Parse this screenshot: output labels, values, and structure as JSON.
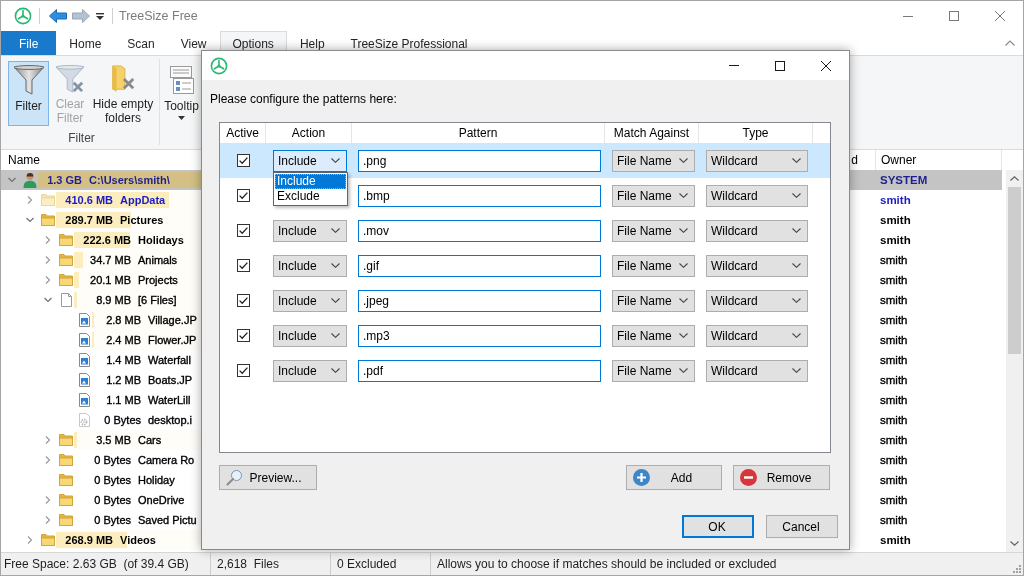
{
  "window": {
    "title": "TreeSize Free"
  },
  "ribbon": {
    "tabs": [
      {
        "label": "File",
        "kind": "backstage",
        "selected": false
      },
      {
        "label": "Home",
        "kind": "tab",
        "selected": false
      },
      {
        "label": "Scan",
        "kind": "tab",
        "selected": false
      },
      {
        "label": "View",
        "kind": "tab",
        "selected": false
      },
      {
        "label": "Options",
        "kind": "tab",
        "selected": true
      },
      {
        "label": "Help",
        "kind": "tab",
        "selected": false
      },
      {
        "label": "TreeSize Professional",
        "kind": "tab",
        "selected": false
      }
    ],
    "groups": [
      {
        "label": "Filter",
        "buttons": [
          {
            "label": "Filter",
            "kind": "filter",
            "selected": true,
            "disabled": false
          },
          {
            "label": "Clear Filter",
            "kind": "clear",
            "selected": false,
            "disabled": true
          },
          {
            "label": "Hide empty folders",
            "kind": "hide",
            "selected": false,
            "disabled": false
          }
        ]
      },
      {
        "buttons": [
          {
            "label": "Tooltip",
            "kind": "tooltip",
            "selected": false,
            "disabled": false
          }
        ]
      }
    ]
  },
  "tree": {
    "columns": [
      {
        "label": "Name"
      },
      {
        "label": "d"
      },
      {
        "label": "Owner"
      }
    ],
    "nodes": [
      {
        "size": "1.3 GB",
        "name": "C:\\Users\\smith\\",
        "owner": "SYSTEM",
        "kind": "user",
        "expanded": true,
        "selected": true,
        "bold": true,
        "color": "#1f1f8f",
        "level": 1,
        "children": [
          {
            "size": "410.6 MB",
            "name": "AppData",
            "owner": "smith",
            "kind": "hidden",
            "expanded": false,
            "selected": false,
            "bold": true,
            "color": "#1c1cc4",
            "level": 0.78
          },
          {
            "size": "289.7 MB",
            "name": "Pictures",
            "owner": "smith",
            "kind": "folder",
            "expanded": true,
            "selected": false,
            "bold": true,
            "color": "#000000",
            "level": 0.52,
            "children": [
              {
                "size": "222.6 MB",
                "name": "Holidays",
                "owner": "smith",
                "kind": "folder",
                "expanded": false,
                "selected": false,
                "bold": true,
                "color": "#000000",
                "level": 0.44
              },
              {
                "size": "34.7 MB",
                "name": "Animals",
                "owner": "smith",
                "kind": "folder",
                "expanded": false,
                "selected": false,
                "bold": false,
                "color": "#000000",
                "level": 0.07
              },
              {
                "size": "20.1 MB",
                "name": "Projects",
                "owner": "smith",
                "kind": "folder",
                "expanded": false,
                "selected": false,
                "bold": false,
                "color": "#000000",
                "level": 0.04
              },
              {
                "size": "8.9 MB",
                "name": "[6 Files]",
                "owner": "smith",
                "kind": "files",
                "expanded": true,
                "selected": false,
                "bold": false,
                "color": "#000000",
                "level": 0.02,
                "children": [
                  {
                    "size": "2.8 MB",
                    "name": "Village.JP",
                    "owner": "smith",
                    "kind": "image",
                    "selected": false,
                    "bold": false,
                    "color": "#000000",
                    "level": 0.02
                  },
                  {
                    "size": "2.4 MB",
                    "name": "Flower.JP",
                    "owner": "smith",
                    "kind": "image",
                    "selected": false,
                    "bold": false,
                    "color": "#000000",
                    "level": 0.02
                  },
                  {
                    "size": "1.4 MB",
                    "name": "Waterfall",
                    "owner": "smith",
                    "kind": "image",
                    "selected": false,
                    "bold": false,
                    "color": "#000000"
                  },
                  {
                    "size": "1.2 MB",
                    "name": "Boats.JP",
                    "owner": "smith",
                    "kind": "image",
                    "selected": false,
                    "bold": false,
                    "color": "#000000"
                  },
                  {
                    "size": "1.1 MB",
                    "name": "WaterLill",
                    "owner": "smith",
                    "kind": "image",
                    "selected": false,
                    "bold": false,
                    "color": "#000000"
                  },
                  {
                    "size": "0 Bytes",
                    "name": "desktop.i",
                    "owner": "smith",
                    "kind": "system",
                    "selected": false,
                    "bold": false,
                    "color": "#000000"
                  }
                ]
              },
              {
                "size": "3.5 MB",
                "name": "Cars",
                "owner": "smith",
                "kind": "folder",
                "expanded": false,
                "selected": false,
                "bold": false,
                "color": "#000000",
                "level": 0.02
              },
              {
                "size": "0 Bytes",
                "name": "Camera Ro",
                "owner": "smith",
                "kind": "folder",
                "expanded": false,
                "selected": false,
                "bold": false,
                "color": "#000000"
              },
              {
                "size": "0 Bytes",
                "name": "Holiday",
                "owner": "smith",
                "kind": "folder",
                "selected": false,
                "bold": false,
                "color": "#000000"
              },
              {
                "size": "0 Bytes",
                "name": "OneDrive",
                "owner": "smith",
                "kind": "folder",
                "expanded": false,
                "selected": false,
                "bold": false,
                "color": "#000000"
              },
              {
                "size": "0 Bytes",
                "name": "Saved Pictu",
                "owner": "smith",
                "kind": "folder",
                "expanded": false,
                "selected": false,
                "bold": false,
                "color": "#000000"
              }
            ]
          },
          {
            "size": "268.9 MB",
            "name": "Videos",
            "owner": "smith",
            "kind": "folder",
            "expanded": false,
            "selected": false,
            "bold": true,
            "color": "#000000",
            "level": 0.49
          }
        ]
      }
    ]
  },
  "dialog": {
    "instruction": "Please configure the patterns here:",
    "columns": [
      {
        "label": "Active"
      },
      {
        "label": "Action"
      },
      {
        "label": "Pattern"
      },
      {
        "label": "Match Against"
      },
      {
        "label": "Type"
      }
    ],
    "rows": [
      {
        "active": true,
        "action": "Include",
        "action_open": true,
        "pattern": ".png",
        "match_against": "File Name",
        "type": "Wildcard",
        "selected": true
      },
      {
        "active": true,
        "action_open": false,
        "pattern": ".bmp",
        "match_against": "File Name",
        "type": "Wildcard",
        "selected": false
      },
      {
        "active": true,
        "action": "Include",
        "action_open": false,
        "pattern": ".mov",
        "match_against": "File Name",
        "type": "Wildcard",
        "selected": false
      },
      {
        "active": true,
        "action": "Include",
        "action_open": false,
        "pattern": ".gif",
        "match_against": "File Name",
        "type": "Wildcard",
        "selected": false
      },
      {
        "active": true,
        "action": "Include",
        "action_open": false,
        "pattern": ".jpeg",
        "match_against": "File Name",
        "type": "Wildcard",
        "selected": false
      },
      {
        "active": true,
        "action": "Include",
        "action_open": false,
        "pattern": ".mp3",
        "match_against": "File Name",
        "type": "Wildcard",
        "selected": false
      },
      {
        "active": true,
        "action": "Include",
        "action_open": false,
        "pattern": ".pdf",
        "match_against": "File Name",
        "type": "Wildcard",
        "selected": false
      }
    ],
    "action_menu": {
      "options": [
        {
          "label": "Include",
          "selected": true
        },
        {
          "label": "Exclude",
          "selected": false
        }
      ]
    },
    "buttons": [
      {
        "label": "Preview...",
        "kind": "preview"
      },
      {
        "label": "Add",
        "kind": "add"
      },
      {
        "label": "Remove",
        "kind": "remove"
      }
    ],
    "footer_buttons": [
      {
        "label": "OK",
        "default": true
      },
      {
        "label": "Cancel",
        "default": false
      }
    ]
  },
  "status_bar": {
    "fields": [
      "Free Space: 2.63 GB  (of 39.4 GB)",
      "2,618  Files",
      "0 Excluded",
      "Allows you to choose if matches should be included or excluded"
    ]
  }
}
